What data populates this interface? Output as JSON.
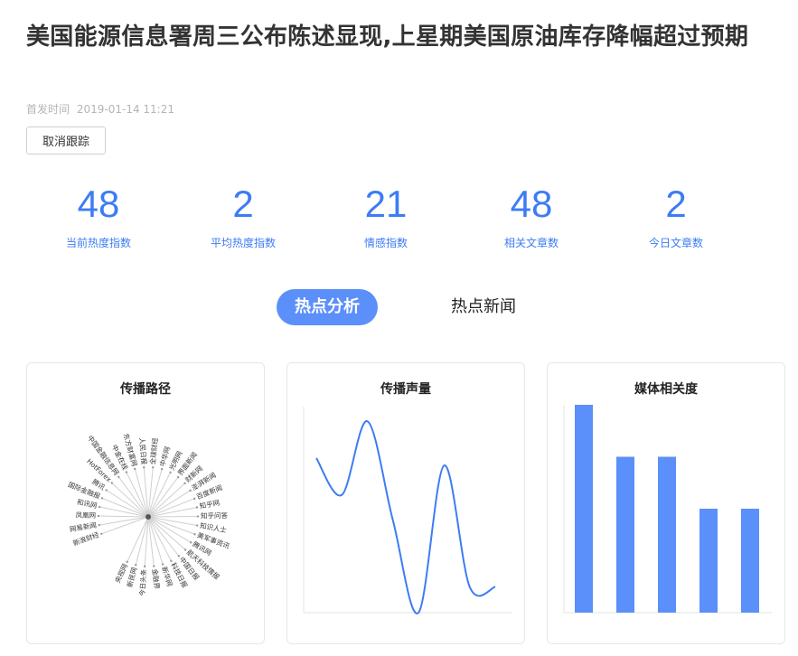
{
  "article": {
    "title": "美国能源信息署周三公布陈述显现,上星期美国原油库存降幅超过预期",
    "published_label": "首发时间",
    "published_time": "2019-01-14 11:21",
    "untrack_button": "取消跟踪"
  },
  "stats": [
    {
      "value": "48",
      "label": "当前热度指数"
    },
    {
      "value": "2",
      "label": "平均热度指数"
    },
    {
      "value": "21",
      "label": "情感指数"
    },
    {
      "value": "48",
      "label": "相关文章数"
    },
    {
      "value": "2",
      "label": "今日文章数"
    }
  ],
  "colors": {
    "accent": "#3d7cf4",
    "tab_active_bg": "#5b8ff9",
    "bar": "#5b8ff9",
    "line": "#3d7cf4"
  },
  "tabs": [
    {
      "label": "热点分析",
      "active": true
    },
    {
      "label": "热点新闻",
      "active": false
    }
  ],
  "cards": {
    "propagation_path": {
      "title": "传播路径",
      "nodes": [
        "新浪财经",
        "网易新闻",
        "凤凰网",
        "和讯网",
        "国际金融报",
        "腾讯",
        "HotForex",
        "中国金融信息网",
        "中金在线",
        "东方财富网",
        "人民日报",
        "全球财经",
        "中华网",
        "光明网",
        "界面新闻",
        "财新网",
        "澎湃新闻",
        "百度新闻",
        "知乎网",
        "知乎问答",
        "知识人士",
        "美军事资讯",
        "腾讯网",
        "航天科技情报",
        "中国日报",
        "科技日报",
        "新华网",
        "金融界",
        "今日头条",
        "新民网",
        "央视网"
      ]
    },
    "volume": {
      "title": "传播声量",
      "chart_data": {
        "type": "line",
        "x": [
          1,
          2,
          3,
          4,
          5,
          6,
          7,
          8
        ],
        "values": [
          36,
          26,
          46,
          19,
          -6,
          34,
          1,
          1
        ],
        "title": "传播声量"
      }
    },
    "media_relevance": {
      "title": "媒体相关度",
      "chart_data": {
        "type": "bar",
        "categories": [
          "1",
          "2",
          "3",
          "4",
          "5"
        ],
        "values": [
          8,
          6,
          6,
          4,
          4
        ],
        "ylim": [
          0,
          8
        ],
        "title": "媒体相关度"
      }
    }
  }
}
